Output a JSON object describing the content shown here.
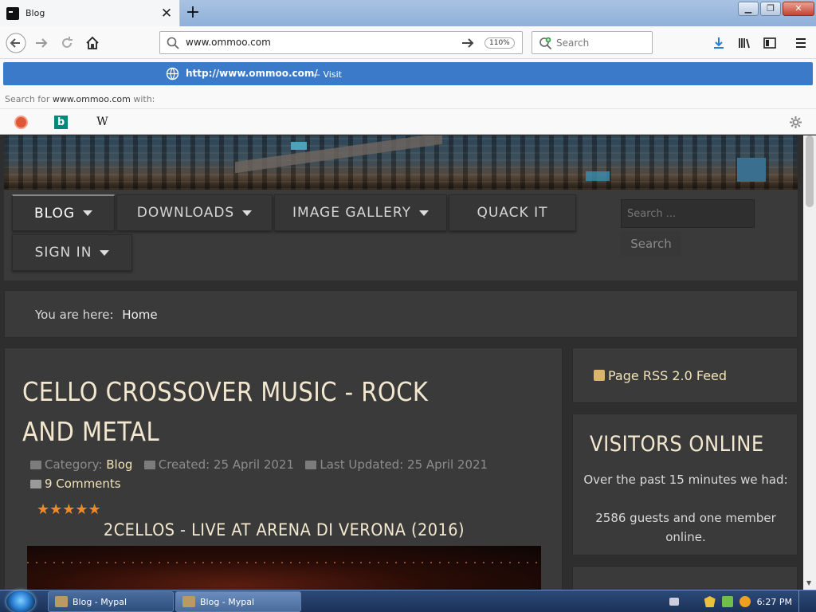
{
  "browser": {
    "tab_title": "Blog",
    "tab_close": "✕",
    "new_tab": "+",
    "url": "www.ommoo.com",
    "zoom": "110%",
    "search_placeholder": "Search",
    "dropdown": {
      "visit_url": "http://www.ommoo.com/",
      "visit_dash": "—",
      "visit_label": "Visit",
      "search_for_prefix": "Search for",
      "search_for_term": "www.ommoo.com",
      "search_for_suffix": "with:",
      "engines": [
        "duckduckgo-icon",
        "bing-icon",
        "wikipedia-icon"
      ],
      "wiki_letter": "W",
      "bing_letter": "b"
    }
  },
  "site": {
    "menu": [
      {
        "label": "BLOG",
        "has_caret": true
      },
      {
        "label": "DOWNLOADS",
        "has_caret": true
      },
      {
        "label": "IMAGE GALLERY",
        "has_caret": true
      },
      {
        "label": "QUACK IT",
        "has_caret": false
      },
      {
        "label": "SIGN IN",
        "has_caret": true
      }
    ],
    "search_placeholder": "Search ...",
    "search_button": "Search",
    "breadcrumb": {
      "prefix": "You are here:",
      "current": "Home"
    },
    "article": {
      "title": "CELLO CROSSOVER MUSIC - ROCK AND METAL",
      "category_label": "Category:",
      "category": "Blog",
      "created": "Created: 25 April 2021",
      "updated": "Last Updated: 25 April 2021",
      "comments": "9 Comments",
      "rating": 5,
      "stars": "★★★★★",
      "video_title": "2CELLOS - LIVE AT ARENA DI VERONA (2016)"
    },
    "sidebar": {
      "rss": "Page RSS 2.0 Feed",
      "visitors_title": "VISITORS ONLINE",
      "visitors_line1": "Over the past 15 minutes we had:",
      "visitors_line2": "2586 guests and one member online."
    }
  },
  "taskbar": {
    "items": [
      "Blog - Mypal",
      "Blog - Mypal"
    ],
    "clock": "6:27 PM"
  },
  "colors": {
    "accent_blue": "#3b7ac9",
    "title_cream": "#f3e8cf",
    "link_gold": "#f1e3b5",
    "star_orange": "#f08a24"
  }
}
